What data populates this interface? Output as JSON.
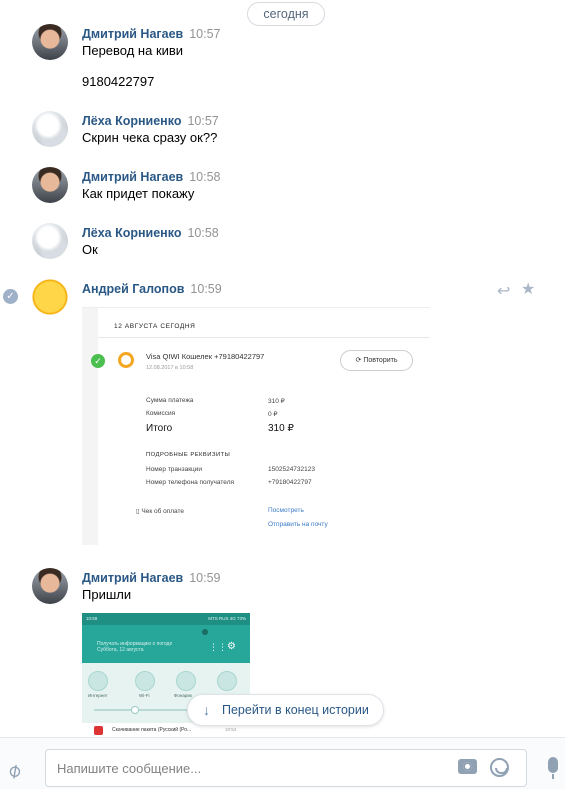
{
  "date_separator": "сегодня",
  "messages": [
    {
      "author": "Дмитрий Нагаев",
      "time": "10:57",
      "lines": [
        "Перевод на киви",
        "9180422797"
      ]
    },
    {
      "author": "Лёха Корниенко",
      "time": "10:57",
      "lines": [
        "Скрин чека сразу ок??"
      ]
    },
    {
      "author": "Дмитрий Нагаев",
      "time": "10:58",
      "lines": [
        "Как придет покажу"
      ]
    },
    {
      "author": "Лёха Корниенко",
      "time": "10:58",
      "lines": [
        "Ок"
      ]
    },
    {
      "author": "Андрей Галопов",
      "time": "10:59",
      "lines": []
    },
    {
      "author": "Дмитрий Нагаев",
      "time": "10:59",
      "lines": [
        "Пришли"
      ]
    }
  ],
  "receipt": {
    "header": "12 АВГУСТА СЕГОДНЯ",
    "wallet": "Visa QIWI Кошелек +79180422797",
    "datetime": "12.08.2017 в 10:58",
    "repeat": "Повторить",
    "sum_label": "Сумма платежа",
    "sum_value": "310 ₽",
    "fee_label": "Комиссия",
    "fee_value": "0 ₽",
    "total_label": "Итого",
    "total_value": "310 ₽",
    "details_title": "ПОДРОБНЫЕ РЕКВИЗИТЫ",
    "txn_label": "Номер транзакции",
    "txn_value": "1502524732123",
    "phone_label": "Номер телефона получателя",
    "phone_value": "+79180422797",
    "check_label": "Чек об оплате",
    "view_link": "Посмотреть",
    "mail_link": "Отправить на почту"
  },
  "phone_screen": {
    "status_left": "10:59",
    "status_right": "MTS RUS 4G 73%",
    "line1": "Получать информацию о погоде",
    "line2": "Суббота, 12 августа",
    "tile1": "Интернет",
    "tile2": "Wi-Fi",
    "tile3": "Фонарик",
    "notification": "Скачивание пакета (Русский (Ро...",
    "notification_time": "10:54"
  },
  "jump_button": "Перейти в конец истории",
  "composer": {
    "placeholder": "Напишите сообщение..."
  },
  "colors": {
    "author": "#2a5885",
    "time": "#939393",
    "accent": "#5181b8"
  }
}
